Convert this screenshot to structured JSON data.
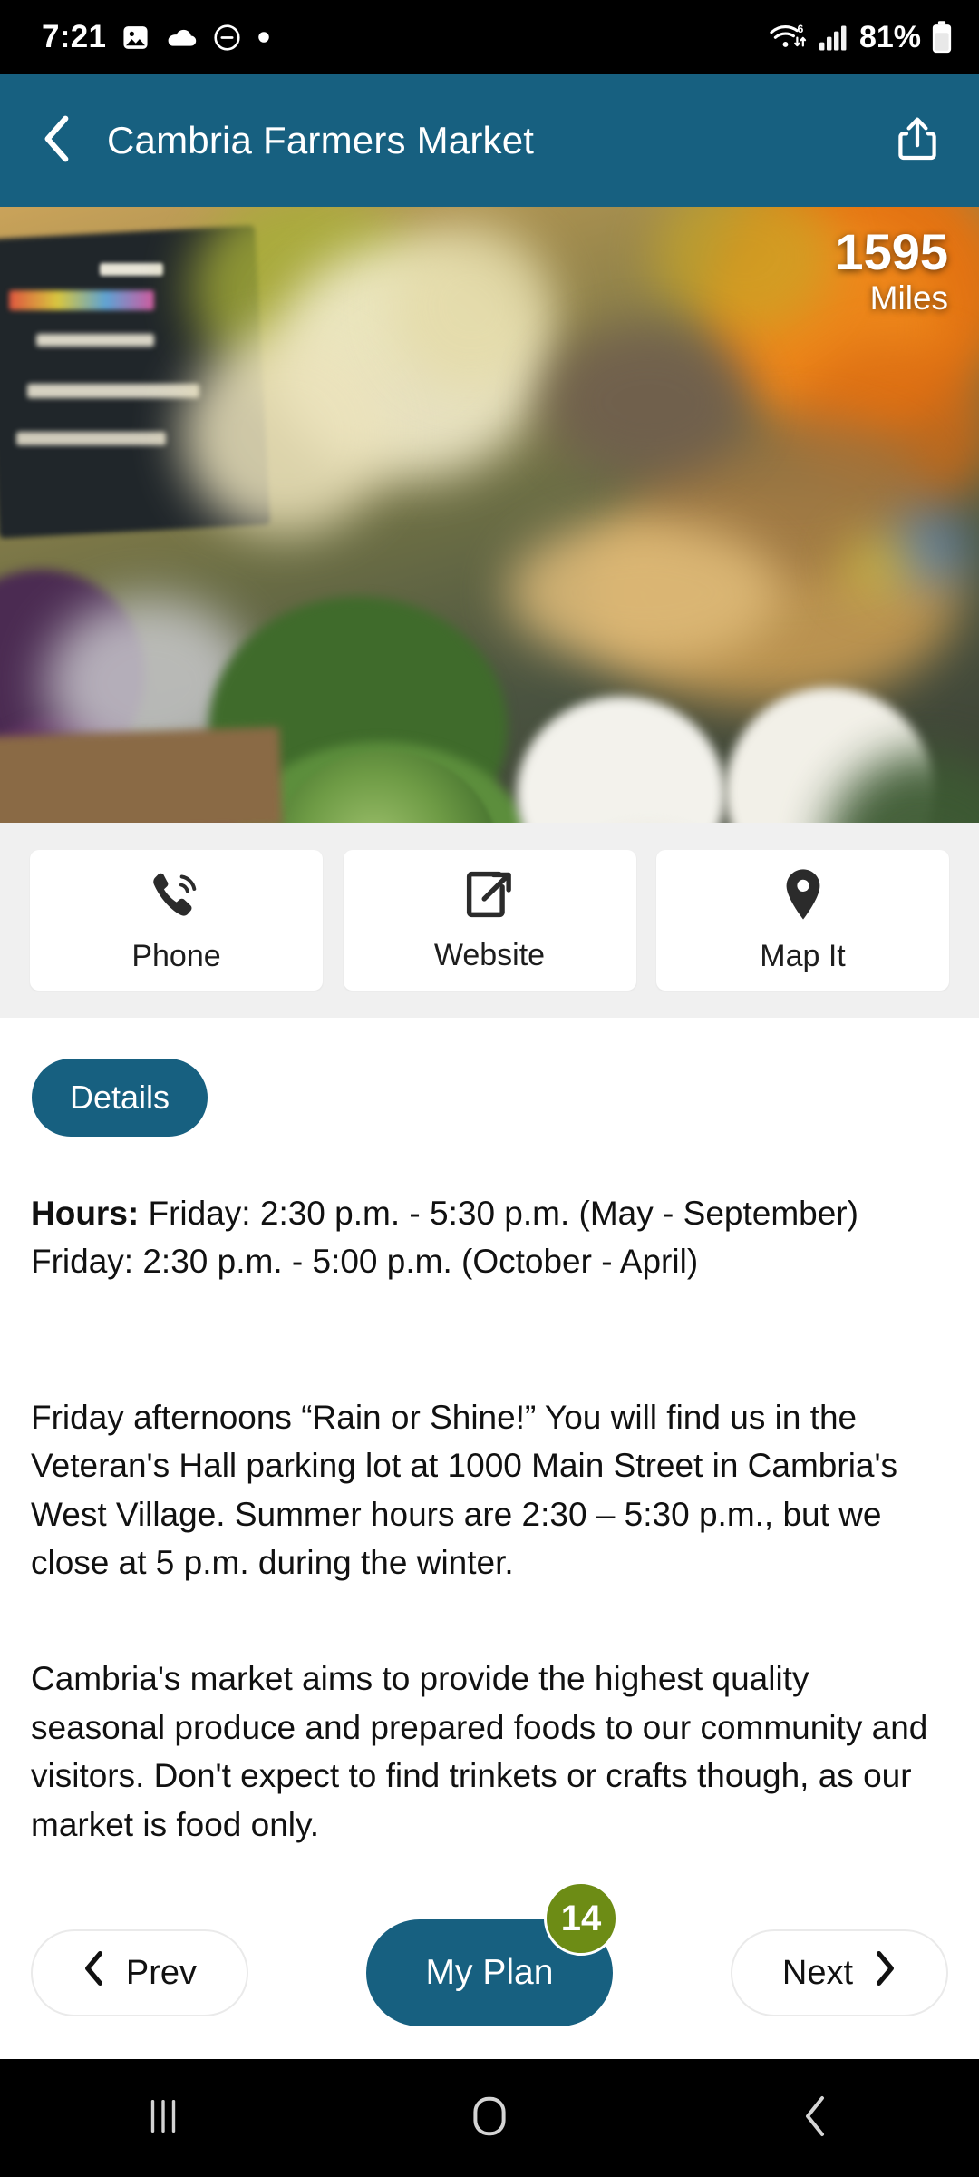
{
  "status_bar": {
    "time": "7:21",
    "battery_percent": "81%",
    "icons": [
      "photo-icon",
      "cloud-icon",
      "do-not-disturb-icon",
      "dot-icon",
      "wifi-icon",
      "cellular-signal-icon",
      "battery-icon"
    ],
    "wifi_generation": "6"
  },
  "header": {
    "title": "Cambria Farmers Market",
    "back_icon": "chevron-left-icon",
    "share_icon": "share-icon",
    "background_color": "#176080"
  },
  "hero": {
    "distance_value": "1595",
    "distance_unit": "Miles",
    "description": "farmers market produce stall with cauliflower, savoy cabbage, purple eggplant, carrots and a chalkboard price sign"
  },
  "actions": [
    {
      "label": "Phone",
      "icon": "phone-icon"
    },
    {
      "label": "Website",
      "icon": "external-link-icon"
    },
    {
      "label": "Map It",
      "icon": "map-pin-icon"
    }
  ],
  "tabs": [
    {
      "label": "Details",
      "active": true
    }
  ],
  "hours": {
    "label": "Hours:",
    "line1": " Friday: 2:30 p.m. - 5:30 p.m. (May - September)",
    "line2": "Friday: 2:30 p.m. - 5:00 p.m. (October - April)"
  },
  "body": {
    "paragraph1": "Friday afternoons “Rain or Shine!” You will find us in the Veteran's Hall parking lot at 1000 Main Street in Cambria's West Village. Summer hours are 2:30 – 5:30 p.m., but we close at 5 p.m. during the winter.",
    "paragraph2": "Cambria's market aims to provide the highest quality seasonal produce and prepared foods to our community and visitors. Don't expect to find trinkets or crafts though, as our market is food only."
  },
  "bottom_bar": {
    "prev_label": "Prev",
    "prev_icon": "chevron-left-icon",
    "next_label": "Next",
    "next_icon": "chevron-right-icon",
    "plan_label": "My Plan",
    "plan_badge_count": "14",
    "plan_color": "#176080",
    "badge_color": "#6d8c15"
  },
  "system_nav": {
    "recents_icon": "recents-icon",
    "home_icon": "home-icon",
    "back_icon": "back-icon"
  }
}
